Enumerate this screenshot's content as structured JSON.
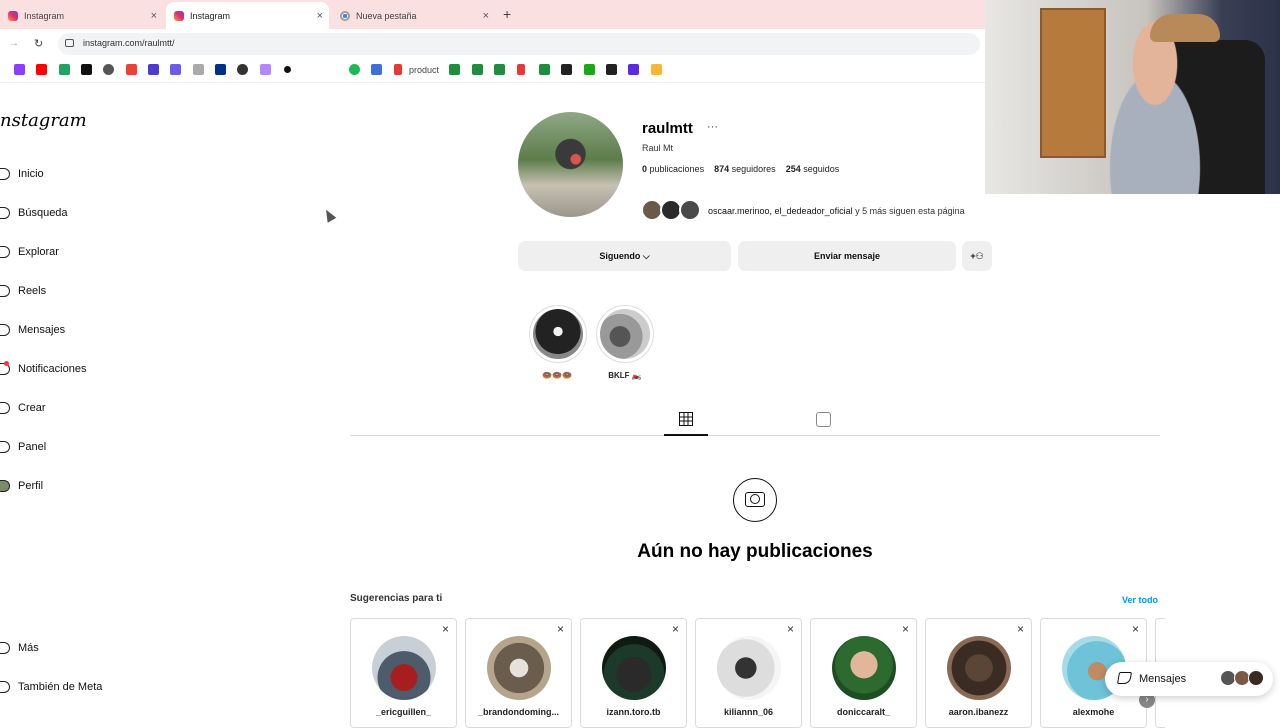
{
  "browser": {
    "tabs": [
      {
        "title": "Instagram",
        "favicon": "instagram-icon",
        "active": false
      },
      {
        "title": "Instagram",
        "favicon": "instagram-icon",
        "active": true
      },
      {
        "title": "Nueva pestaña",
        "favicon": "chrome-icon",
        "active": false
      }
    ],
    "new_tab": "+",
    "close_glyph": "×",
    "url": "instagram.com/raulmtt/",
    "bookmark_product": "product"
  },
  "sidebar": {
    "logo": "nstagram",
    "items": [
      {
        "label": "Inicio",
        "icon": "home-icon"
      },
      {
        "label": "Búsqueda",
        "icon": "search-icon"
      },
      {
        "label": "Explorar",
        "icon": "compass-icon"
      },
      {
        "label": "Reels",
        "icon": "reels-icon"
      },
      {
        "label": "Mensajes",
        "icon": "messenger-icon"
      },
      {
        "label": "Notificaciones",
        "icon": "heart-icon"
      },
      {
        "label": "Crear",
        "icon": "plus-icon"
      },
      {
        "label": "Panel",
        "icon": "chart-icon"
      },
      {
        "label": "Perfil",
        "icon": "avatar-icon"
      }
    ],
    "bottom": [
      {
        "label": "Más",
        "icon": "menu-icon"
      },
      {
        "label": "También de Meta",
        "icon": "meta-icon"
      }
    ]
  },
  "profile": {
    "username": "raulmtt",
    "more": "···",
    "full_name": "Raul Mt",
    "posts_count": "0",
    "posts_label": "publicaciones",
    "followers_count": "874",
    "followers_label": "seguidores",
    "following_count": "254",
    "following_label": "seguidos",
    "followed_by_names": "oscaar.merinoo, el_dedeador_oficial",
    "followed_by_rest": " y 5 más siguen esta página",
    "following_button": "Siguendo ⌵",
    "message_button": "Enviar mensaje",
    "add_person_icon": "+⁠⚇"
  },
  "highlights": [
    {
      "label": "🍩🍩🍩"
    },
    {
      "label": "BKLF 🏍️"
    }
  ],
  "content": {
    "empty_title": "Aún no hay publicaciones"
  },
  "suggestions": {
    "title": "Sugerencias para ti",
    "see_all": "Ver todo",
    "dismiss": "×",
    "users": [
      {
        "name": "_ericguillen_"
      },
      {
        "name": "_brandondoming..."
      },
      {
        "name": "izann.toro.tb"
      },
      {
        "name": "kiliannn_06"
      },
      {
        "name": "doniccaralt_"
      },
      {
        "name": "aaron.ibanezz"
      },
      {
        "name": "alexmohe"
      }
    ]
  },
  "messages_pill": {
    "label": "Mensajes"
  },
  "colors": {
    "tabbar_bg": "#fbe0e2",
    "link_blue": "#0095f6",
    "button_bg": "#efefef"
  }
}
